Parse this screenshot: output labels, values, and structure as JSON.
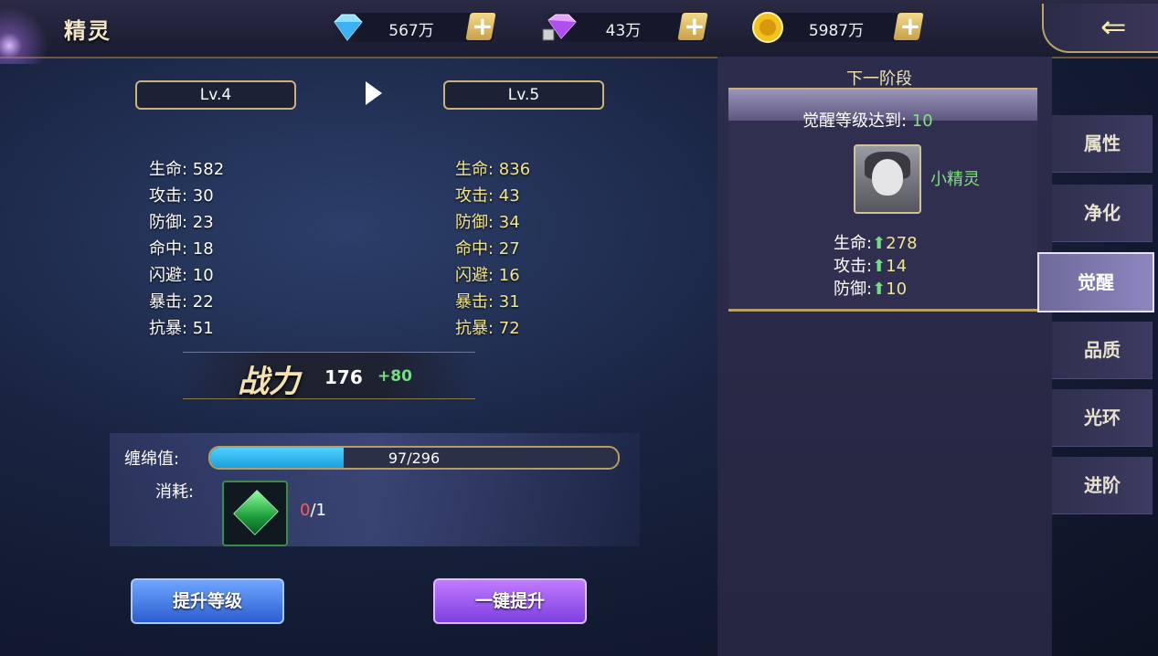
{
  "header": {
    "title": "精灵",
    "currencies": [
      {
        "icon": "diamond-icon",
        "value": "567万"
      },
      {
        "icon": "locked-gem-icon",
        "value": "43万"
      },
      {
        "icon": "gold-coin-icon",
        "value": "5987万"
      }
    ],
    "back_icon": "back-arrow-icon"
  },
  "levels": {
    "current": "Lv.4",
    "next": "Lv.5"
  },
  "stats_current": [
    "生命: 582",
    "攻击: 30",
    "防御: 23",
    "命中: 18",
    "闪避: 10",
    "暴击: 22",
    "抗暴: 51"
  ],
  "stats_next": [
    "生命: 836",
    "攻击: 43",
    "防御: 34",
    "命中: 27",
    "闪避: 16",
    "暴击: 31",
    "抗暴: 72"
  ],
  "power": {
    "label": "战力",
    "value": "176",
    "increase": "+80"
  },
  "bond": {
    "label": "缠绵值:",
    "current": 97,
    "max": 296,
    "text": "97/296"
  },
  "cost": {
    "label": "消耗:",
    "have": "0",
    "need": "/1",
    "item_icon": "green-crystal-icon"
  },
  "buttons": {
    "upgrade": "提升等级",
    "one_click": "一键提升"
  },
  "next_stage": {
    "title": "下一阶段",
    "requirement_label": "觉醒等级达到: ",
    "requirement_value": "10",
    "sprite_name": "小精灵",
    "bonuses": [
      {
        "label": "生命:",
        "value": "278"
      },
      {
        "label": "攻击:",
        "value": "14"
      },
      {
        "label": "防御:",
        "value": "10"
      }
    ]
  },
  "tabs": [
    {
      "label": "属性",
      "active": false
    },
    {
      "label": "净化",
      "active": false
    },
    {
      "label": "觉醒",
      "active": true
    },
    {
      "label": "品质",
      "active": false
    },
    {
      "label": "光环",
      "active": false
    },
    {
      "label": "进阶",
      "active": false
    }
  ],
  "colors": {
    "accent_gold": "#cbb37a",
    "bar_blue": "#1aa0de",
    "green": "#7fe37b",
    "yellow": "#f3e68a"
  }
}
